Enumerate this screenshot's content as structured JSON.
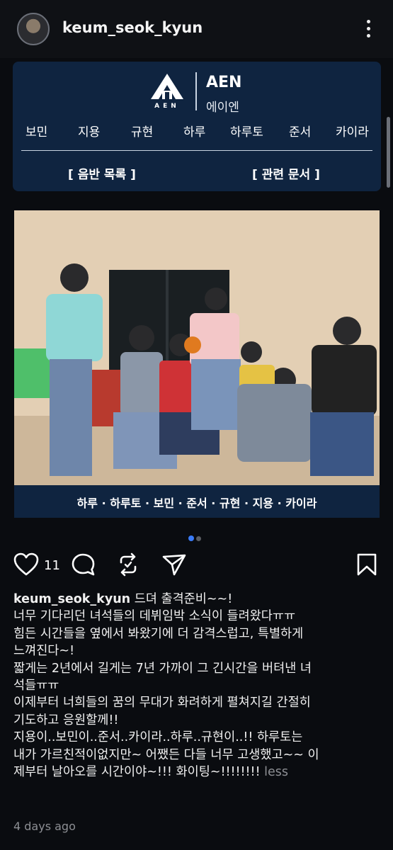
{
  "header": {
    "username": "keum_seok_kyun"
  },
  "card": {
    "logo_name": "AEN",
    "logo_sub": "에이엔",
    "logo_mark_text": "AEN",
    "members": [
      "보민",
      "지용",
      "규현",
      "하루",
      "하루토",
      "준서",
      "카이라"
    ],
    "links": [
      "[ 음반 목록 ]",
      "[ 관련 문서 ]"
    ]
  },
  "photo": {
    "caption": "하루 · 하루토 · 보민 · 준서 · 규현 · 지용 · 카이라"
  },
  "carousel": {
    "dots": 2,
    "active": 0,
    "active_color": "#3a7bf7",
    "inactive_color": "#5a5d63"
  },
  "actions": {
    "like_count": "11"
  },
  "post": {
    "author": "keum_seok_kyun",
    "text": " 드뎌 출격준비~~!\n너무 기다리던 녀석들의 데뷔임박 소식이 들려왔다ㅠㅠ\n힘든 시간들을 옆에서 봐왔기에 더 감격스럽고, 특별하게\n느껴진다~!\n짧게는 2년에서 길게는 7년 가까이 그 긴시간을 버텨낸 녀\n석들ㅠㅠ\n이제부터 너희들의 꿈의 무대가 화려하게 펼쳐지길 간절히\n기도하고 응원할께!!\n지용이..보민이..준서..카이라..하루..규현이..!! 하루토는\n내가 가르친적이없지만~ 어쨌든 다들 너무 고생했고~~ 이\n제부터 날아오를 시간이야~!!! 화이팅~!!!!!!!! ",
    "less": "less",
    "timestamp": "4 days ago"
  }
}
